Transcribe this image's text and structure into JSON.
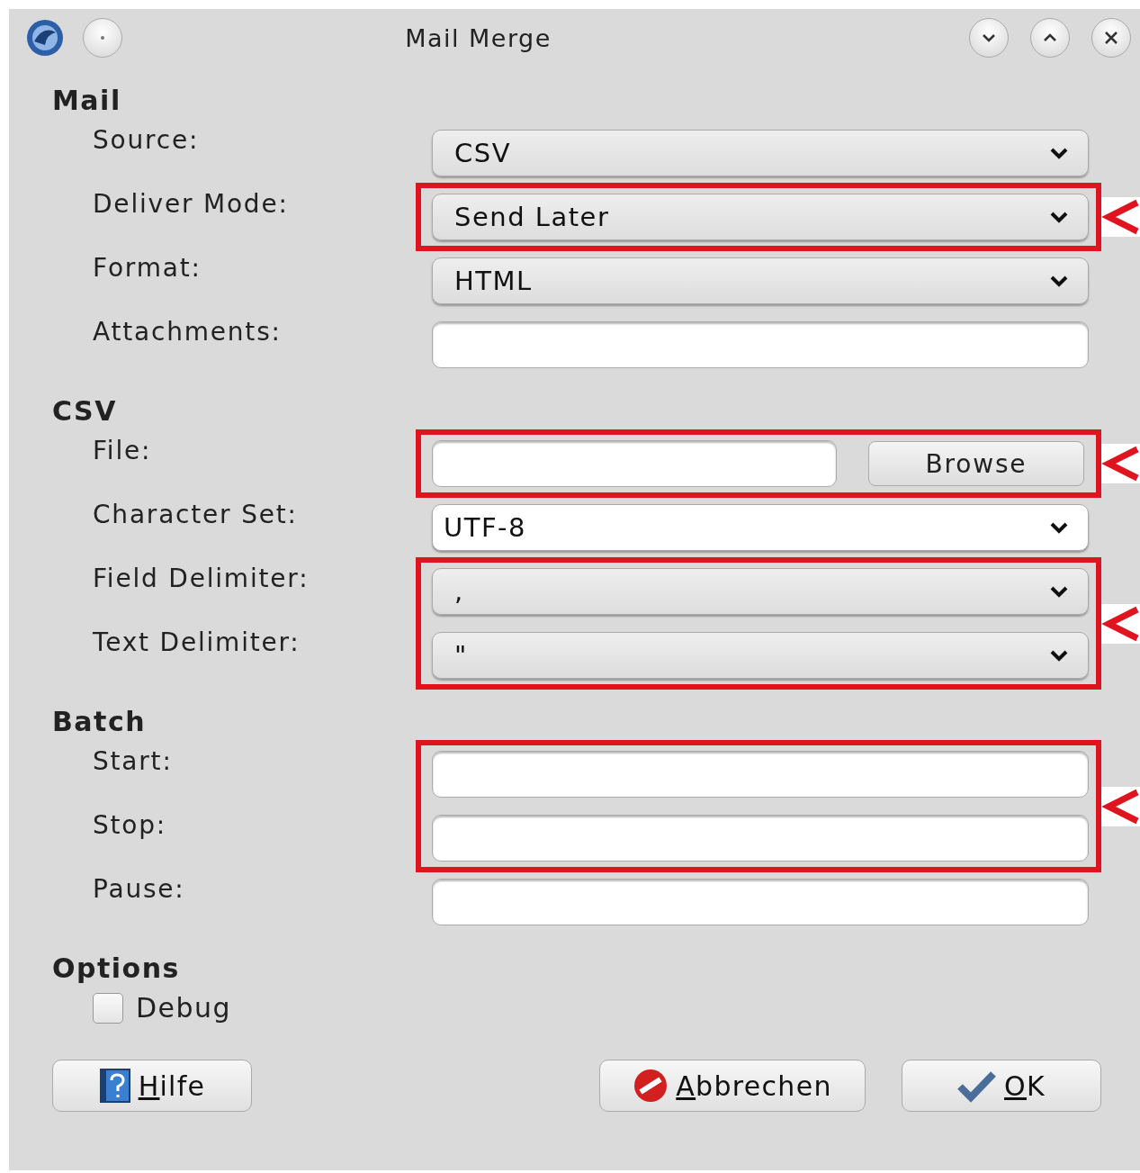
{
  "window": {
    "title": "Mail Merge"
  },
  "sections": [
    {
      "heading": "Mail",
      "groups": [
        {
          "highlighted": false,
          "rows": [
            {
              "label": "Source:",
              "kind": "select",
              "value": "CSV"
            }
          ]
        },
        {
          "highlighted": true,
          "rows": [
            {
              "label": "Deliver Mode:",
              "kind": "select",
              "value": "Send Later"
            }
          ]
        },
        {
          "highlighted": false,
          "rows": [
            {
              "label": "Format:",
              "kind": "select",
              "value": "HTML"
            },
            {
              "label": "Attachments:",
              "kind": "input"
            }
          ]
        }
      ]
    },
    {
      "heading": "CSV",
      "groups": [
        {
          "highlighted": true,
          "rows": [
            {
              "label": "File:",
              "kind": "file",
              "button": "Browse"
            }
          ]
        },
        {
          "highlighted": false,
          "rows": [
            {
              "label": "Character Set:",
              "kind": "combo",
              "value": "UTF-8"
            }
          ]
        },
        {
          "highlighted": true,
          "rows": [
            {
              "label": "Field Delimiter:",
              "kind": "select",
              "value": ","
            },
            {
              "label": "Text Delimiter:",
              "kind": "select",
              "value": "\""
            }
          ]
        }
      ]
    },
    {
      "heading": "Batch",
      "groups": [
        {
          "highlighted": true,
          "rows": [
            {
              "label": "Start:",
              "kind": "input"
            },
            {
              "label": "Stop:",
              "kind": "input"
            }
          ]
        },
        {
          "highlighted": false,
          "rows": [
            {
              "label": "Pause:",
              "kind": "input"
            }
          ]
        }
      ]
    },
    {
      "heading": "Options",
      "checkboxes": [
        {
          "label": "Debug",
          "checked": false
        }
      ]
    }
  ],
  "buttons": [
    {
      "label": "Hilfe",
      "kind": "help"
    },
    {
      "label": "Abbrechen",
      "kind": "cancel"
    },
    {
      "label": "OK",
      "kind": "ok"
    }
  ]
}
